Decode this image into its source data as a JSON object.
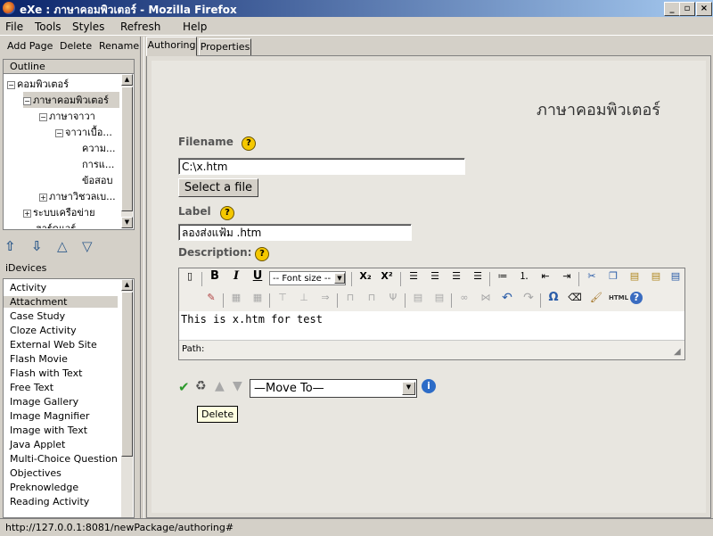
{
  "window": {
    "title": "eXe : ภาษาคอมพิวเตอร์ - Mozilla Firefox"
  },
  "menu": [
    "File",
    "Tools",
    "Styles",
    "Refresh",
    "Help"
  ],
  "left_toolbar": {
    "add_page": "Add Page",
    "delete": "Delete",
    "rename": "Rename"
  },
  "outline": {
    "header": "Outline",
    "nodes": [
      {
        "label": "คอมพิวเตอร์",
        "expander": "−"
      },
      {
        "label": "ภาษาคอมพิวเตอร์",
        "expander": "−"
      },
      {
        "label": "ภาษาจาวา",
        "expander": "−"
      },
      {
        "label": "จาวาเบื้อ...",
        "expander": "−"
      },
      {
        "label": "ความ..."
      },
      {
        "label": "การแ..."
      },
      {
        "label": "ข้อสอบ"
      },
      {
        "label": "ภาษาวิชวลเบ...",
        "expander": "+"
      },
      {
        "label": "ระบบเครือข่าย",
        "expander": "+"
      },
      {
        "label": "ฮาร์ดแวร์"
      }
    ]
  },
  "idevices": {
    "label": "iDevices",
    "items": [
      "Activity",
      "Attachment",
      "Case Study",
      "Cloze Activity",
      "External Web Site",
      "Flash Movie",
      "Flash with Text",
      "Free Text",
      "Image Gallery",
      "Image Magnifier",
      "Image with Text",
      "Java Applet",
      "Multi-Choice Question",
      "Objectives",
      "Preknowledge",
      "Reading Activity"
    ],
    "selected": "Attachment"
  },
  "tabs": {
    "authoring": "Authoring",
    "properties": "Properties"
  },
  "content": {
    "page_heading": "ภาษาคอมพิวเตอร์",
    "filename_label": "Filename",
    "filename_value": "C:\\x.htm",
    "select_file_button": "Select a file",
    "label_label": "Label",
    "label_value": "ลองส่งแฟ้ม .htm",
    "description_label": "Description:",
    "font_size": "-- Font size --",
    "editor_text": "This is x.htm for test",
    "path_label": "Path:",
    "move_to": "—Move To—",
    "tooltip": "Delete"
  },
  "toolbar_icons": {
    "bold": "B",
    "italic": "I",
    "underline": "U",
    "omega": "Ω",
    "html": "HTML",
    "help": "?"
  },
  "status_bar": {
    "url": "http://127.0.0.1:8081/newPackage/authoring#"
  },
  "colors": {
    "titlebar_start": "#0a246a",
    "titlebar_end": "#a6caf0",
    "help_yellow": "#f5c800",
    "arrow_blue": "#315c8c"
  }
}
